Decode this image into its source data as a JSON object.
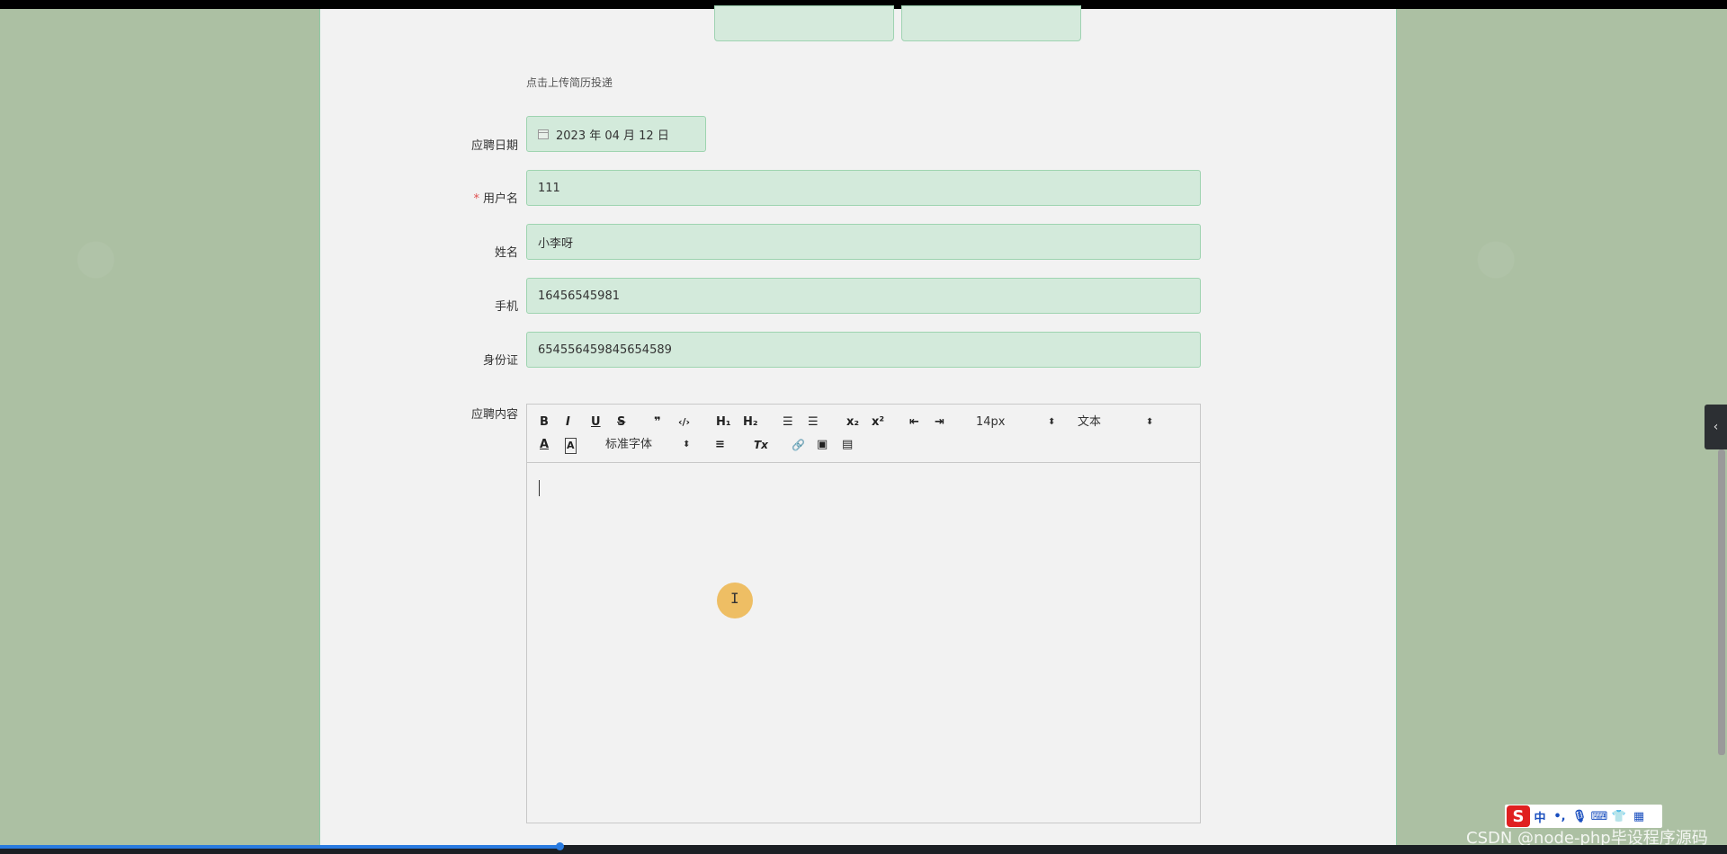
{
  "form": {
    "upload_hint": "点击上传简历投递",
    "fields": [
      {
        "label": "应聘日期",
        "value": "2023 年 04 月 12 日",
        "required": false
      },
      {
        "label": "用户名",
        "value": "111",
        "required": true
      },
      {
        "label": "姓名",
        "value": "小李呀",
        "required": false
      },
      {
        "label": "手机",
        "value": "16456545981",
        "required": false
      },
      {
        "label": "身份证",
        "value": "654556459845654589",
        "required": false
      }
    ],
    "required_mark": "*",
    "content_label": "应聘内容"
  },
  "editor": {
    "buttons": {
      "bold": "B",
      "italic": "I",
      "underline": "U",
      "strike": "S",
      "quote": "❞",
      "code": "‹/›",
      "h1": "H₁",
      "h2": "H₂",
      "ordered_list": "☰",
      "bullet_list": "☰",
      "subscript": "x₂",
      "superscript": "x²",
      "outdent": "⇤",
      "indent": "⇥",
      "color": "A",
      "background": "A",
      "align": "≡",
      "clean": "Tx",
      "link": "🔗",
      "image": "▣",
      "video": "▤"
    },
    "size_select": "14px",
    "header_select": "文本",
    "font_select": "标准字体",
    "select_arrow": "⬍"
  },
  "ime": {
    "logo": "S",
    "items": [
      "中",
      "•,",
      "🎙",
      "⌨",
      "👕",
      "▦"
    ]
  },
  "watermark": "CSDN @node-php毕设程序源码",
  "side_tab_icon": "‹"
}
